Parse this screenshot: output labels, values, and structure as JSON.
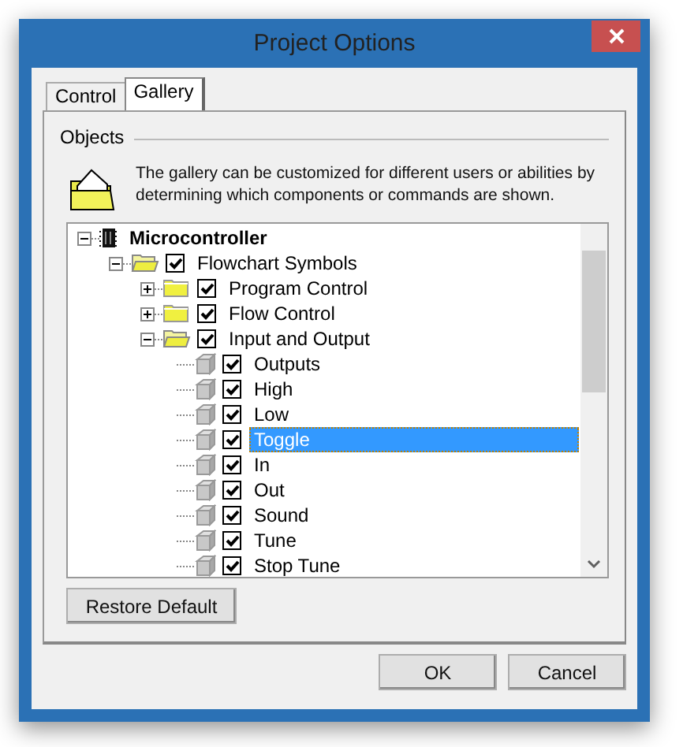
{
  "window": {
    "title": "Project Options"
  },
  "tabs": [
    {
      "label": "Control",
      "selected": false
    },
    {
      "label": "Gallery",
      "selected": true
    }
  ],
  "group": {
    "title": "Objects",
    "description": "The gallery can be customized for different users or abilities by determining which components or commands are shown."
  },
  "tree": [
    {
      "label": "Microcontroller",
      "kind": "chip",
      "expanded": true,
      "selected": false,
      "children": [
        {
          "label": "Flowchart Symbols",
          "kind": "folder",
          "expanded": true,
          "checked": true,
          "selected": false,
          "children": [
            {
              "label": "Program Control",
              "kind": "folder",
              "expanded": false,
              "checked": true,
              "selected": false
            },
            {
              "label": "Flow Control",
              "kind": "folder",
              "expanded": false,
              "checked": true,
              "selected": false
            },
            {
              "label": "Input and Output",
              "kind": "folder",
              "expanded": true,
              "checked": true,
              "selected": false,
              "children": [
                {
                  "label": "Outputs",
                  "kind": "block",
                  "checked": true,
                  "selected": false
                },
                {
                  "label": "High",
                  "kind": "block",
                  "checked": true,
                  "selected": false
                },
                {
                  "label": "Low",
                  "kind": "block",
                  "checked": true,
                  "selected": false
                },
                {
                  "label": "Toggle",
                  "kind": "block",
                  "checked": true,
                  "selected": true
                },
                {
                  "label": "In",
                  "kind": "block",
                  "checked": true,
                  "selected": false
                },
                {
                  "label": "Out",
                  "kind": "block",
                  "checked": true,
                  "selected": false
                },
                {
                  "label": "Sound",
                  "kind": "block",
                  "checked": true,
                  "selected": false
                },
                {
                  "label": "Tune",
                  "kind": "block",
                  "checked": true,
                  "selected": false
                },
                {
                  "label": "Stop Tune",
                  "kind": "block",
                  "checked": true,
                  "selected": false
                }
              ]
            }
          ]
        }
      ]
    }
  ],
  "restore_button": "Restore Default",
  "buttons": [
    "OK",
    "Cancel"
  ]
}
